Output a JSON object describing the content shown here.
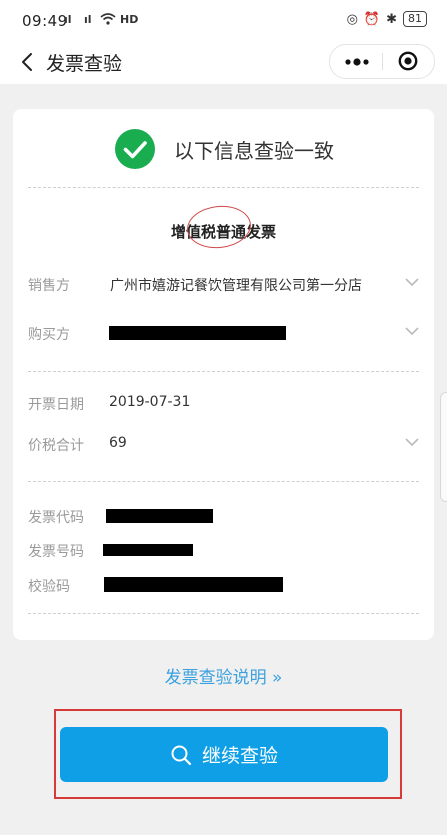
{
  "status_bar": {
    "time": "09:49",
    "signal_1": "⁴ᴳ",
    "signal_2": "⁴ᴳ",
    "network_label": "HD",
    "battery": "81"
  },
  "nav": {
    "title": "发票查验"
  },
  "result": {
    "message": "以下信息查验一致",
    "invoice_type": "增值税普通发票",
    "success_color": "#1aad4f"
  },
  "fields": {
    "seller": {
      "label": "销售方",
      "value": "广州市嬉游记餐饮管理有限公司第一分店"
    },
    "buyer": {
      "label": "购买方",
      "value": ""
    },
    "issue_date": {
      "label": "开票日期",
      "value": "2019-07-31"
    },
    "total": {
      "label": "价税合计",
      "value": "69"
    },
    "invoice_code": {
      "label": "发票代码",
      "value": ""
    },
    "invoice_number": {
      "label": "发票号码",
      "value": ""
    },
    "check_code": {
      "label": "校验码",
      "value": ""
    }
  },
  "help_link": "发票查验说明 »",
  "continue_button": {
    "label": "继续查验",
    "icon": "search-icon",
    "color": "#0e9fe6"
  }
}
